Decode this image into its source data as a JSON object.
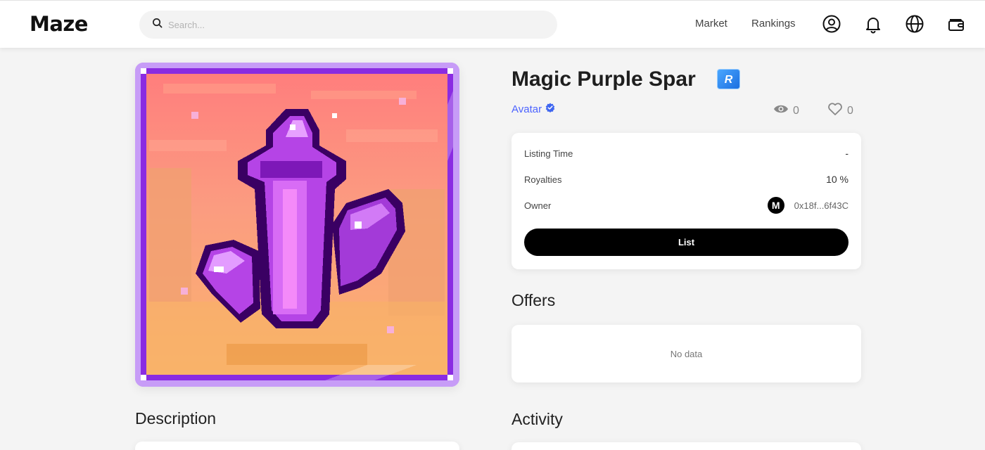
{
  "header": {
    "logo": "Maze",
    "search_placeholder": "Search...",
    "nav": {
      "market": "Market",
      "rankings": "Rankings"
    },
    "icons": [
      "user-circle-icon",
      "bell-icon",
      "globe-icon",
      "wallet-icon"
    ]
  },
  "nft": {
    "title": "Magic Purple Spar",
    "rarity": "R",
    "collection": "Avatar",
    "views": "0",
    "likes": "0",
    "image_description_icon": "purple-crystal-pixel-art"
  },
  "info": {
    "listing_time_label": "Listing Time",
    "listing_time_value": "-",
    "royalties_label": "Royalties",
    "royalties_value": "10 %",
    "owner_label": "Owner",
    "owner_avatar": "M",
    "owner_address": "0x18f...6f43C",
    "list_button": "List"
  },
  "sections": {
    "offers": "Offers",
    "offers_empty": "No data",
    "description": "Description",
    "activity": "Activity"
  },
  "colors": {
    "accent_link": "#4c63ff",
    "rarity_badge": "#2f86f0",
    "primary_button": "#000000",
    "frame_purple": "#9b3df0"
  }
}
